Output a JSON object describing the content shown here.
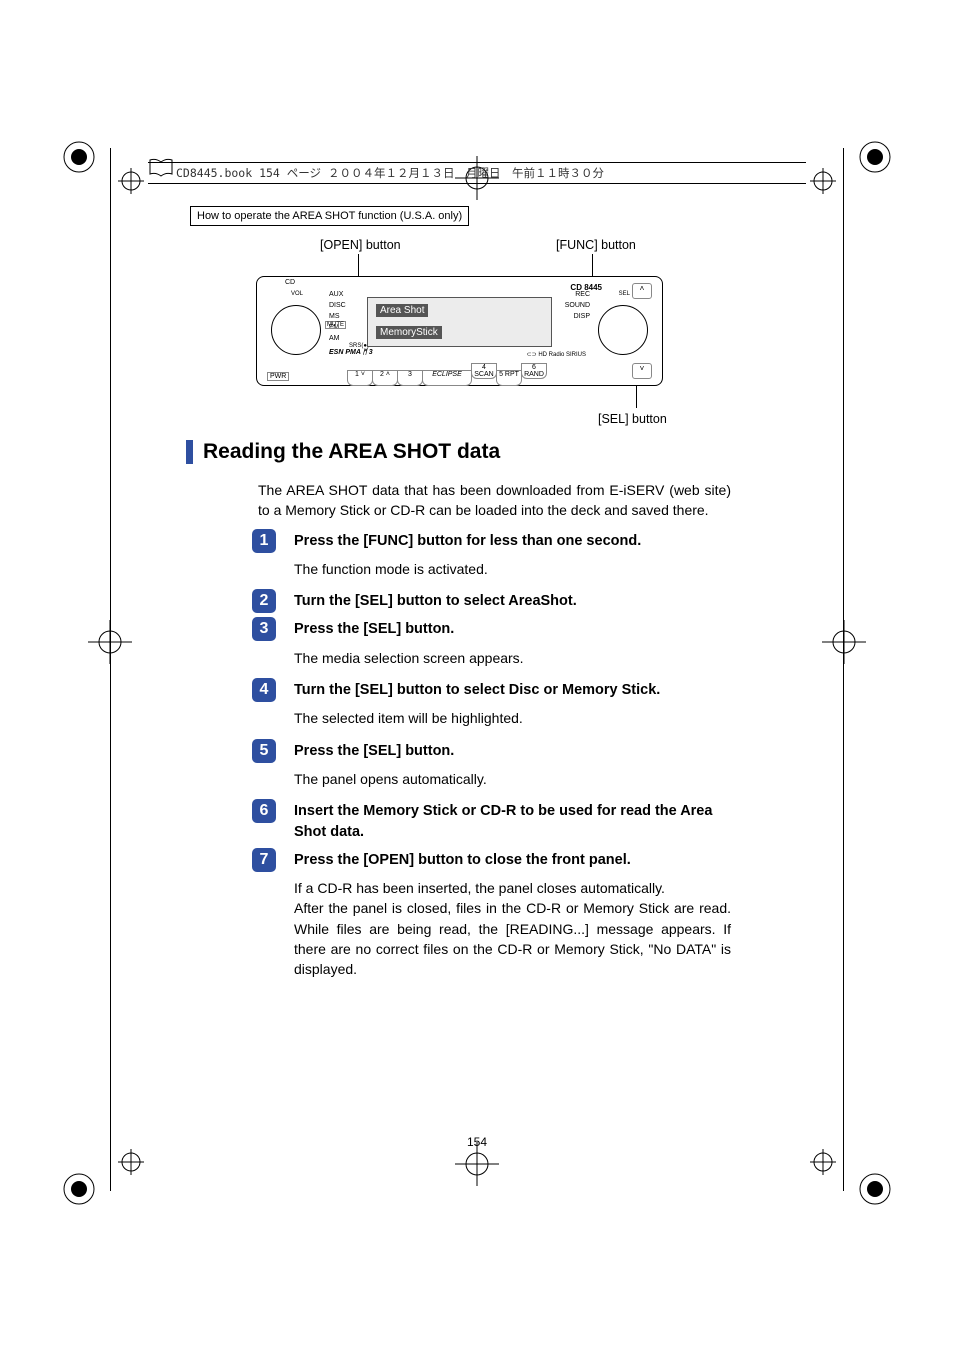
{
  "book_header": "CD8445.book  154 ページ  ２００４年１２月１３日　月曜日　午前１１時３０分",
  "section_header": "How to operate the AREA SHOT function (U.S.A. only)",
  "callouts": {
    "open": "[OPEN] button",
    "func": "[FUNC] button",
    "sel": "[SEL] button"
  },
  "device": {
    "model": "CD 8445",
    "screen_line1": "Area Shot",
    "screen_line2": "MemoryStick",
    "left_labels": "AUX\nDISC\nMS\nFM\nAM",
    "mute": "MUTE",
    "srs": "SRS(●)",
    "esn": "ESN PMA ᛗ 3",
    "right_labels": "REC\nSOUND\nDISP",
    "sel": "SEL",
    "vol": "VOL",
    "logos": "⊂⊃  HD Radio  SIRIUS",
    "pwr": "PWR",
    "buttons": [
      "1 ˅",
      "2 ˄",
      "3",
      "ECLIPSE",
      "4 SCAN",
      "5 RPT",
      "6 RAND"
    ],
    "cd": "CD",
    "up": "˄",
    "dn": "˅"
  },
  "heading": "Reading the AREA SHOT data",
  "intro": "The AREA SHOT data that has been downloaded from E-iSERV (web site) to a Memory Stick or CD-R can be loaded into the deck and saved there.",
  "steps": [
    {
      "num": "1",
      "title": "Press the [FUNC] button for less than one second.",
      "body": "The function mode is activated."
    },
    {
      "num": "2",
      "title": "Turn the [SEL] button to select AreaShot.",
      "body": ""
    },
    {
      "num": "3",
      "title": "Press the [SEL] button.",
      "body": "The media selection screen appears."
    },
    {
      "num": "4",
      "title": "Turn the [SEL] button to select Disc or Memory Stick.",
      "body": "The selected item will be highlighted."
    },
    {
      "num": "5",
      "title": "Press the [SEL] button.",
      "body": "The panel opens automatically."
    },
    {
      "num": "6",
      "title": "Insert the Memory Stick or CD-R to be used for read the Area Shot data.",
      "body": ""
    },
    {
      "num": "7",
      "title": "Press the [OPEN] button to close the front panel.",
      "body": "If a CD-R has been inserted, the panel closes automatically.\nAfter the panel is closed, files in the CD-R or Memory Stick are read. While files are being read, the [READING...] message appears. If there are no correct files on the CD-R or Memory Stick, \"No DATA\" is displayed."
    }
  ],
  "page_number": "154"
}
